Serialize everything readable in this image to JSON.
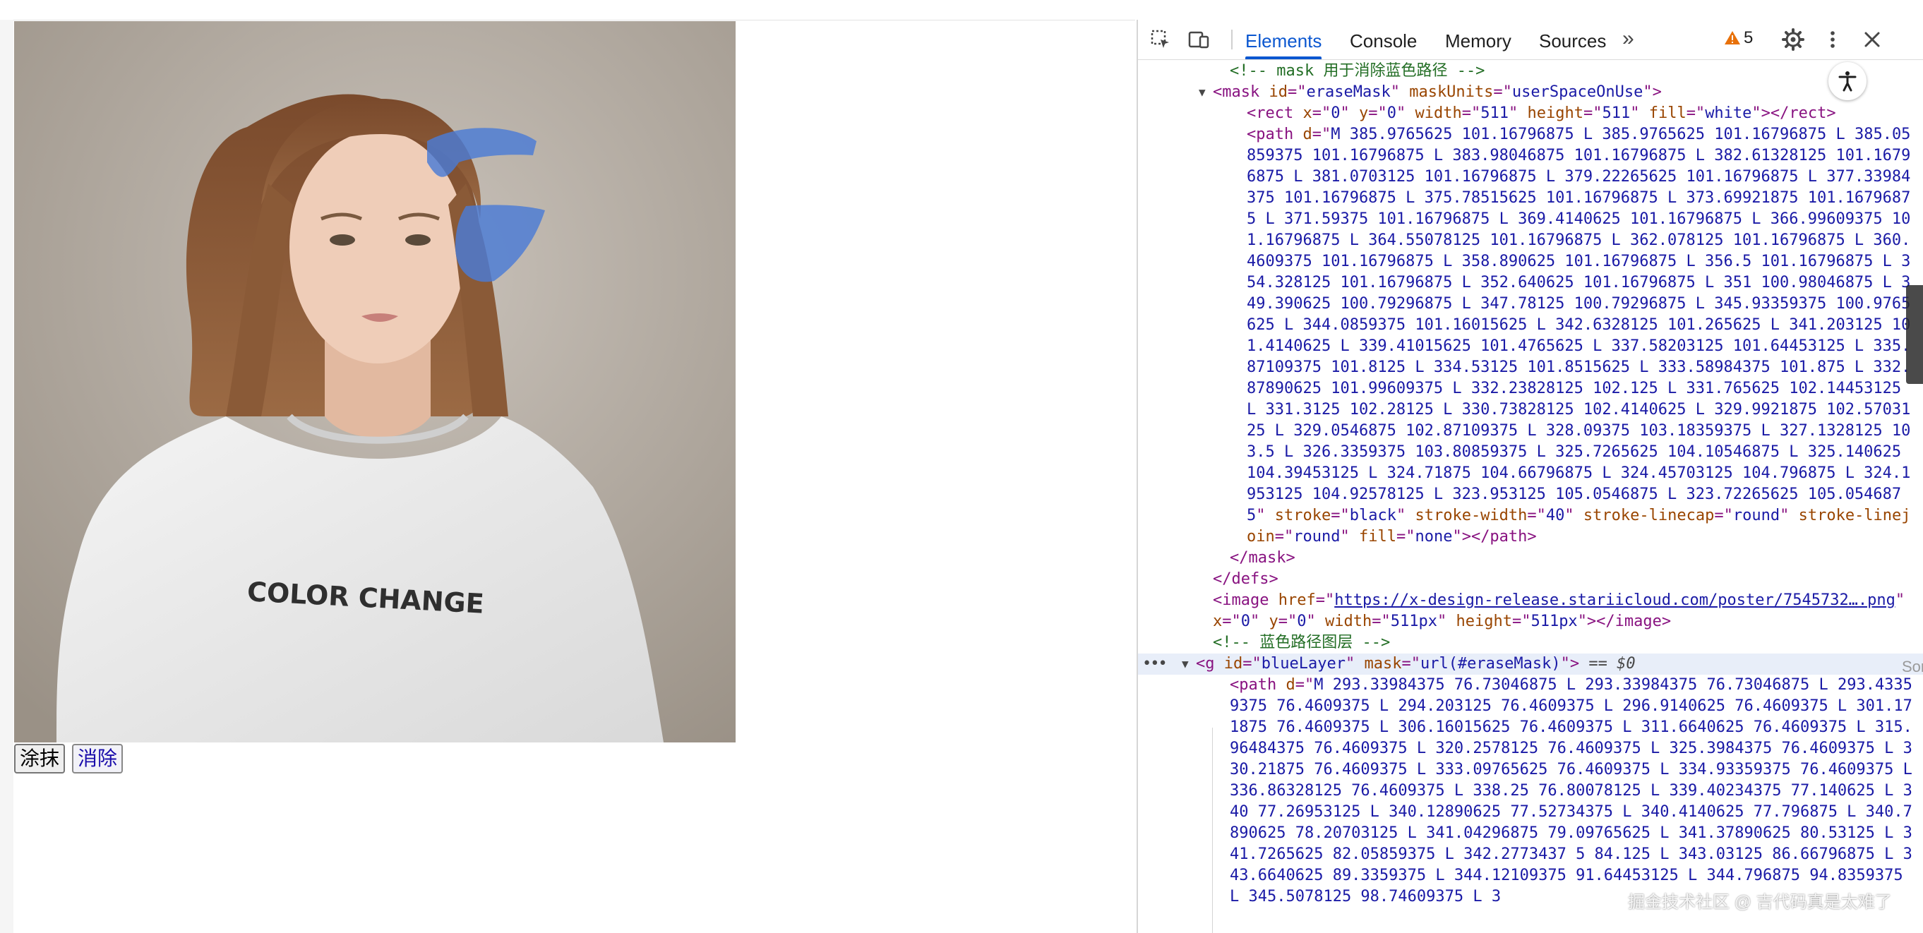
{
  "page": {
    "tshirt_text": "COLOR CHANGE",
    "buttons": [
      {
        "label": "涂抹"
      },
      {
        "label": "消除"
      }
    ]
  },
  "devtools": {
    "tabs": [
      {
        "label": "Elements",
        "active": true
      },
      {
        "label": "Console",
        "active": false
      },
      {
        "label": "Memory",
        "active": false
      },
      {
        "label": "Sources",
        "active": false
      }
    ],
    "issues_count": "5",
    "watermark": "掘金技术社区 @ 吉代码真是太难了",
    "edge_text": "Son",
    "rows": [
      {
        "depth": 5,
        "kind": "tree",
        "segs": [
          [
            "com",
            "<!-- mask 用于消除蓝色路径 -->"
          ]
        ]
      },
      {
        "depth": 4,
        "kind": "tree",
        "tri": "▼",
        "segs": [
          [
            "tag",
            "<mask "
          ],
          [
            "an",
            "id"
          ],
          [
            "tag",
            "=\""
          ],
          [
            "av",
            "eraseMask"
          ],
          [
            "tag",
            "\" "
          ],
          [
            "an",
            "maskUnits"
          ],
          [
            "tag",
            "=\""
          ],
          [
            "av",
            "userSpaceOnUse"
          ],
          [
            "tag",
            "\">"
          ]
        ]
      },
      {
        "depth": 6,
        "kind": "tree",
        "segs": [
          [
            "tag",
            "<rect "
          ],
          [
            "an",
            "x"
          ],
          [
            "tag",
            "=\""
          ],
          [
            "av",
            "0"
          ],
          [
            "tag",
            "\" "
          ],
          [
            "an",
            "y"
          ],
          [
            "tag",
            "=\""
          ],
          [
            "av",
            "0"
          ],
          [
            "tag",
            "\" "
          ],
          [
            "an",
            "width"
          ],
          [
            "tag",
            "=\""
          ],
          [
            "av",
            "511"
          ],
          [
            "tag",
            "\" "
          ],
          [
            "an",
            "height"
          ],
          [
            "tag",
            "=\""
          ],
          [
            "av",
            "511"
          ],
          [
            "tag",
            "\" "
          ],
          [
            "an",
            "fill"
          ],
          [
            "tag",
            "=\""
          ],
          [
            "av",
            "white"
          ],
          [
            "tag",
            "\"></rect>"
          ]
        ]
      },
      {
        "depth": 6,
        "kind": "long",
        "segs": [
          [
            "tag",
            "<path "
          ],
          [
            "an",
            "d"
          ],
          [
            "tag",
            "=\""
          ],
          [
            "av",
            "M 385.9765625 101.16796875 L 385.9765625 101.16796875 L 385.05859375 101.16796875 L 383.98046875 101.16796875 L 382.61328125 101.16796875 L 381.0703125 101.16796875 L 379.22265625 101.16796875 L 377.33984375 101.16796875 L 375.78515625 101.16796875 L 373.69921875 101.16796875 L 371.59375 101.16796875 L 369.4140625 101.16796875 L 366.99609375 101.16796875 L 364.55078125 101.16796875 L 362.078125 101.16796875 L 360.4609375 101.16796875 L 358.890625 101.16796875 L 356.5 101.16796875 L 354.328125 101.16796875 L 352.640625 101.16796875 L 351 100.98046875 L 349.390625 100.79296875 L 347.78125 100.79296875 L 345.93359375 100.9765625 L 344.0859375 101.16015625 L 342.6328125 101.265625 L 341.203125 101.4140625 L 339.41015625 101.4765625 L 337.58203125 101.64453125 L 335.87109375 101.8125 L 334.53125 101.8515625 L 333.58984375 101.875 L 332.87890625 101.99609375 L 332.23828125 102.125 L 331.765625 102.14453125 L 331.3125 102.28125 L 330.73828125 102.4140625 L 329.9921875 102.5703125 L 329.0546875 102.87109375 L 328.09375 103.18359375 L 327.1328125 103.5 L 326.3359375 103.80859375 L 325.7265625 104.10546875 L 325.140625 104.39453125 L 324.71875 104.66796875 L 324.45703125 104.796875 L 324.1953125 104.92578125 L 323.953125 105.0546875 L 323.72265625 105.0546875"
          ],
          [
            "tag",
            "\" "
          ],
          [
            "an",
            "stroke"
          ],
          [
            "tag",
            "=\""
          ],
          [
            "av",
            "black"
          ],
          [
            "tag",
            "\" "
          ],
          [
            "an",
            "stroke-width"
          ],
          [
            "tag",
            "=\""
          ],
          [
            "av",
            "40"
          ],
          [
            "tag",
            "\" "
          ],
          [
            "an",
            "stroke-linecap"
          ],
          [
            "tag",
            "=\""
          ],
          [
            "av",
            "round"
          ],
          [
            "tag",
            "\" "
          ],
          [
            "an",
            "stroke-linejoin"
          ],
          [
            "tag",
            "=\""
          ],
          [
            "av",
            "round"
          ],
          [
            "tag",
            "\" "
          ],
          [
            "an",
            "fill"
          ],
          [
            "tag",
            "=\""
          ],
          [
            "av",
            "none"
          ],
          [
            "tag",
            "\"></path>"
          ]
        ]
      },
      {
        "depth": 5,
        "kind": "tree",
        "segs": [
          [
            "tag",
            "</mask>"
          ]
        ]
      },
      {
        "depth": 4,
        "kind": "tree",
        "segs": [
          [
            "tag",
            "</defs>"
          ]
        ]
      },
      {
        "depth": 4,
        "kind": "long",
        "segs": [
          [
            "tag",
            "<image "
          ],
          [
            "an",
            "href"
          ],
          [
            "tag",
            "=\""
          ],
          [
            "link",
            "https://x-design-release.stariicloud.com/poster/7545732….png"
          ],
          [
            "tag",
            "\" "
          ],
          [
            "an",
            "x"
          ],
          [
            "tag",
            "=\""
          ],
          [
            "av",
            "0"
          ],
          [
            "tag",
            "\" "
          ],
          [
            "an",
            "y"
          ],
          [
            "tag",
            "=\""
          ],
          [
            "av",
            "0"
          ],
          [
            "tag",
            "\" "
          ],
          [
            "an",
            "width"
          ],
          [
            "tag",
            "=\""
          ],
          [
            "av",
            "511px"
          ],
          [
            "tag",
            "\" "
          ],
          [
            "an",
            "height"
          ],
          [
            "tag",
            "=\""
          ],
          [
            "av",
            "511px"
          ],
          [
            "tag",
            "\"></image>"
          ]
        ]
      },
      {
        "depth": 4,
        "kind": "tree",
        "segs": [
          [
            "com",
            "<!-- 蓝色路径图层 -->"
          ]
        ]
      },
      {
        "depth": 3,
        "kind": "tree",
        "tri": "▼",
        "selected": true,
        "segs": [
          [
            "tag",
            "<g "
          ],
          [
            "an",
            "id"
          ],
          [
            "tag",
            "=\""
          ],
          [
            "av",
            "blueLayer"
          ],
          [
            "tag",
            "\" "
          ],
          [
            "an",
            "mask"
          ],
          [
            "tag",
            "=\""
          ],
          [
            "av",
            "url(#eraseMask)"
          ],
          [
            "tag",
            "\">"
          ],
          [
            "eq",
            " == "
          ],
          [
            "var",
            "$0"
          ]
        ]
      },
      {
        "depth": 5,
        "kind": "long",
        "segs": [
          [
            "tag",
            "<path "
          ],
          [
            "an",
            "d"
          ],
          [
            "tag",
            "=\""
          ],
          [
            "av",
            "M 293.33984375 76.73046875 L 293.33984375 76.73046875 L 293.43359375 76.4609375 L 294.203125 76.4609375 L 296.9140625 76.4609375 L 301.171875 76.4609375 L 306.16015625 76.4609375 L 311.6640625 76.4609375 L 315.96484375 76.4609375 L 320.2578125 76.4609375 L 325.3984375 76.4609375 L 330.21875 76.4609375 L 333.09765625 76.4609375 L 334.93359375 76.4609375 L 336.86328125 76.4609375 L 338.25 76.80078125 L 339.40234375 77.140625 L 340 77.26953125 L 340.12890625 77.52734375 L 340.4140625 77.796875 L 340.7890625 78.20703125 L 341.04296875 79.09765625 L 341.37890625 80.53125 L 341.7265625 82.05859375 L 342.2773437 5 84.125 L 343.03125 86.66796875 L 343.6640625 89.3359375 L 344.12109375 91.64453125 L 344.796875 94.8359375 L 345.5078125 98.74609375 L 3"
          ]
        ]
      }
    ]
  }
}
